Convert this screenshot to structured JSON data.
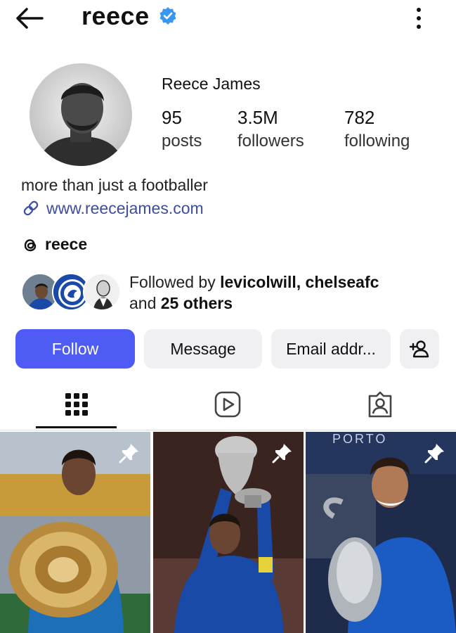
{
  "header": {
    "username": "reece",
    "back_icon": "arrow-left-icon",
    "verified_icon": "verified-badge-icon",
    "more_icon": "more-vertical-icon"
  },
  "profile": {
    "full_name": "Reece James",
    "stats": [
      {
        "value": "95",
        "label": "posts"
      },
      {
        "value": "3.5M",
        "label": "followers"
      },
      {
        "value": "782",
        "label": "following"
      }
    ],
    "bio": "more than just a footballer",
    "link": "www.reecejames.com",
    "threads_handle": "reece",
    "followed_by": {
      "prefix": "Followed by ",
      "names": "levicolwill, chelseafc",
      "and": "and ",
      "others": "25 others"
    }
  },
  "actions": {
    "follow": "Follow",
    "message": "Message",
    "email": "Email addr..."
  },
  "tabs": [
    "posts-grid",
    "reels",
    "tagged"
  ],
  "grid": [
    {
      "pinned": true,
      "caption_visible": ""
    },
    {
      "pinned": true,
      "caption_visible": ""
    },
    {
      "pinned": true,
      "caption_visible": "PORTO"
    }
  ],
  "colors": {
    "accent": "#4f5bf5",
    "verified": "#3897f0",
    "link": "#3d4da0",
    "chelsea_blue": "#1a4aa8"
  }
}
